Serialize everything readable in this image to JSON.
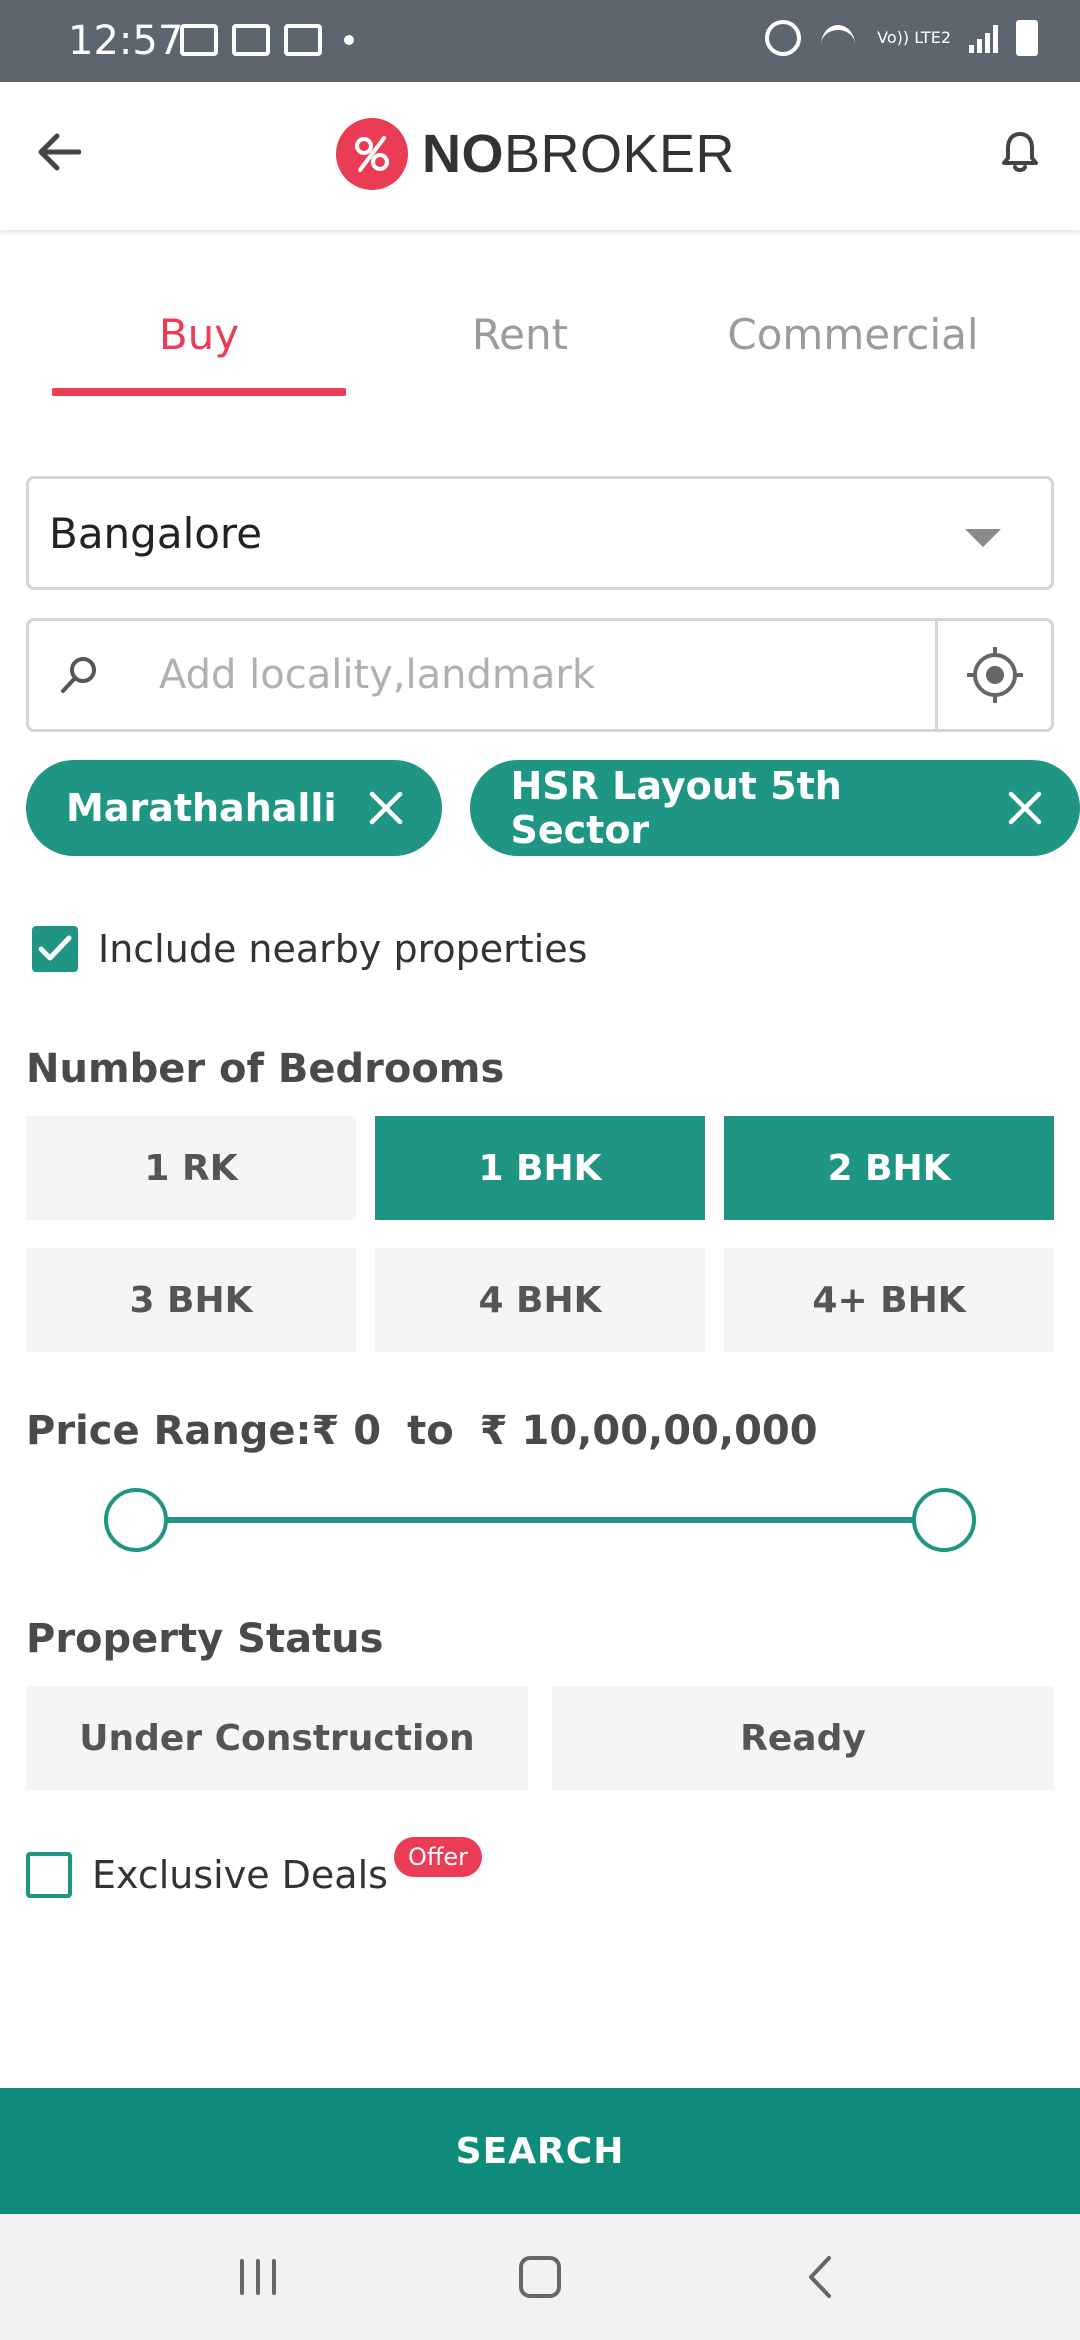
{
  "status_bar": {
    "time": "12:57",
    "network": "Vo)) LTE2"
  },
  "app_bar": {
    "logo_bold": "NO",
    "logo_regular": "BROKER"
  },
  "tabs": [
    {
      "label": "Buy",
      "active": true
    },
    {
      "label": "Rent",
      "active": false
    },
    {
      "label": "Commercial",
      "active": false
    }
  ],
  "city": {
    "value": "Bangalore"
  },
  "search": {
    "placeholder": "Add locality,landmark",
    "value": ""
  },
  "chips": [
    "Marathahalli",
    "HSR Layout 5th Sector"
  ],
  "nearby": {
    "label": "Include nearby properties",
    "checked": true
  },
  "bedrooms": {
    "title": "Number of Bedrooms",
    "options": [
      {
        "label": "1 RK",
        "selected": false
      },
      {
        "label": "1 BHK",
        "selected": true
      },
      {
        "label": "2 BHK",
        "selected": true
      },
      {
        "label": "3 BHK",
        "selected": false
      },
      {
        "label": "4 BHK",
        "selected": false
      },
      {
        "label": "4+ BHK",
        "selected": false
      }
    ]
  },
  "price": {
    "prefix": "Price Range:",
    "min": "₹ 0",
    "to": "to",
    "max": "₹ 10,00,00,000",
    "min_fraction": 0,
    "max_fraction": 1
  },
  "property_status": {
    "title": "Property Status",
    "options": [
      "Under Construction",
      "Ready"
    ]
  },
  "deals": {
    "label": "Exclusive Deals",
    "badge": "Offer",
    "checked": false
  },
  "search_button": {
    "label": "SEARCH"
  },
  "colors": {
    "primary": "#1f9583",
    "accent": "#ea3d55",
    "status_bar": "#5d666e",
    "search_button": "#0f8b7b"
  },
  "icons": [
    "back-arrow-icon",
    "bell-icon",
    "search-icon",
    "locate-icon",
    "close-icon",
    "check-icon",
    "recents-icon",
    "home-icon",
    "chevron-left-icon"
  ]
}
